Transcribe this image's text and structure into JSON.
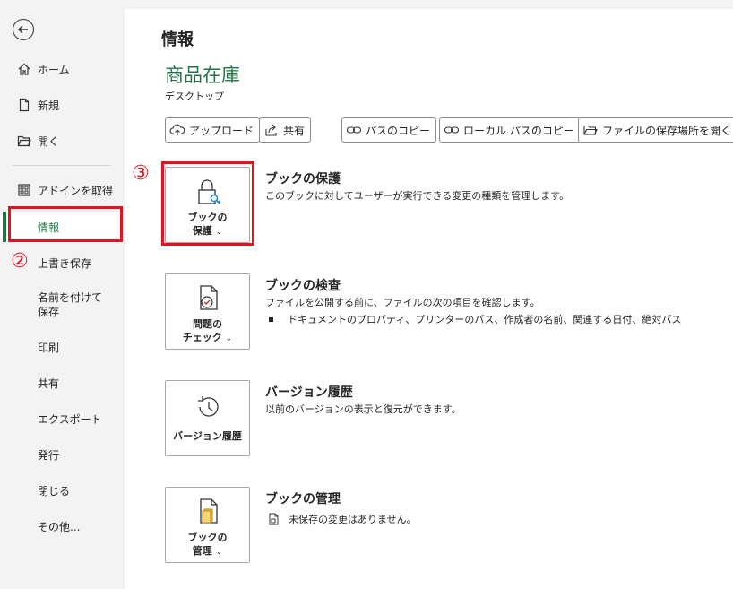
{
  "sidebar": {
    "items": [
      {
        "label": "ホーム",
        "icon": "home-icon"
      },
      {
        "label": "新規",
        "icon": "new-document-icon"
      },
      {
        "label": "開く",
        "icon": "open-folder-icon"
      },
      {
        "label": "アドインを取得",
        "icon": "grid-icon"
      },
      {
        "label": "情報"
      },
      {
        "label": "上書き保存"
      },
      {
        "label": "名前を付けて保存"
      },
      {
        "label": "印刷"
      },
      {
        "label": "共有"
      },
      {
        "label": "エクスポート"
      },
      {
        "label": "発行"
      },
      {
        "label": "閉じる"
      },
      {
        "label": "その他..."
      }
    ],
    "active_item": "情報"
  },
  "annotations": {
    "step2": "②",
    "step3": "③",
    "highlight_color": "#e0141e"
  },
  "main": {
    "title": "情報",
    "file_name": "商品在庫",
    "file_location": "デスクトップ",
    "buttons": [
      {
        "label": "アップロード",
        "icon": "upload-cloud-icon"
      },
      {
        "label": "共有",
        "icon": "share-icon"
      },
      {
        "label": "パスのコピー",
        "icon": "link-icon"
      },
      {
        "label": "ローカル パスのコピー",
        "icon": "link-icon"
      },
      {
        "label": "ファイルの保存場所を開く",
        "icon": "folder-icon"
      }
    ],
    "sections": [
      {
        "tile_line1": "ブックの",
        "tile_line2": "保護",
        "title": "ブックの保護",
        "desc": "このブックに対してユーザーが実行できる変更の種類を管理します。"
      },
      {
        "tile_line1": "問題の",
        "tile_line2": "チェック",
        "title": "ブックの検査",
        "desc": "ファイルを公開する前に、ファイルの次の項目を確認します。",
        "bullet": "ドキュメントのプロパティ、プリンターのパス、作成者の名前、関連する日付、絶対パス"
      },
      {
        "tile_line1": "バージョン履歴",
        "title": "バージョン履歴",
        "desc": "以前のバージョンの表示と復元ができます。"
      },
      {
        "tile_line1": "ブックの",
        "tile_line2": "管理",
        "title": "ブックの管理",
        "status": "未保存の変更はありません。"
      }
    ]
  },
  "colors": {
    "accent": "#217346",
    "sidebar_bg": "#f3f3f3",
    "main_bg": "#ffffff"
  }
}
